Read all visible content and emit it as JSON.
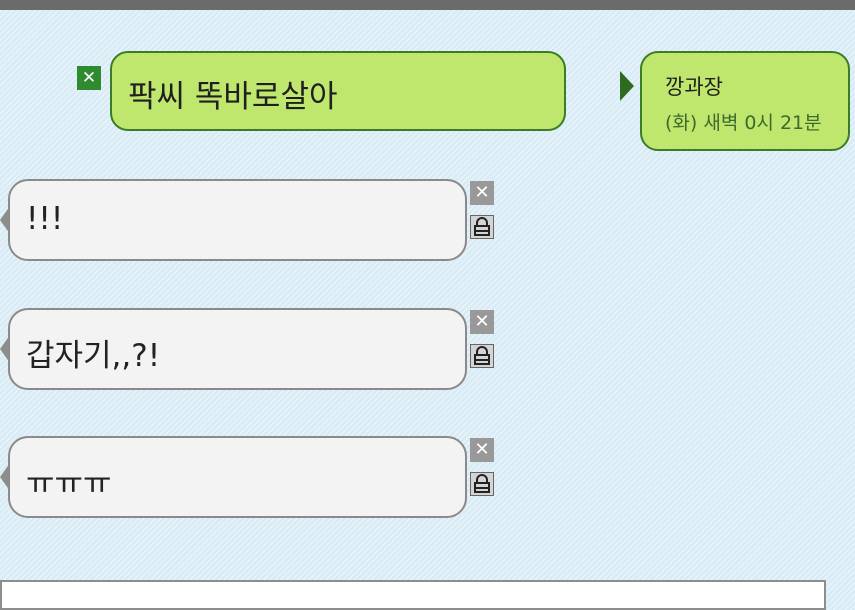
{
  "header": {
    "bar_color": "#6b6b6b"
  },
  "post": {
    "text": "팍씨 똑바로살아",
    "delete_icon": "close-icon",
    "author": "깡과장",
    "time": "(화) 새벽 0시 21분",
    "bubble_color": "#bfe66d"
  },
  "comments": [
    {
      "text": "!!!"
    },
    {
      "text": "갑자기,,?!"
    },
    {
      "text": "ㅠㅠㅠ"
    }
  ],
  "icons": {
    "delete": "close-icon",
    "lock": "lock-icon"
  },
  "comment_input": {
    "placeholder": ""
  }
}
